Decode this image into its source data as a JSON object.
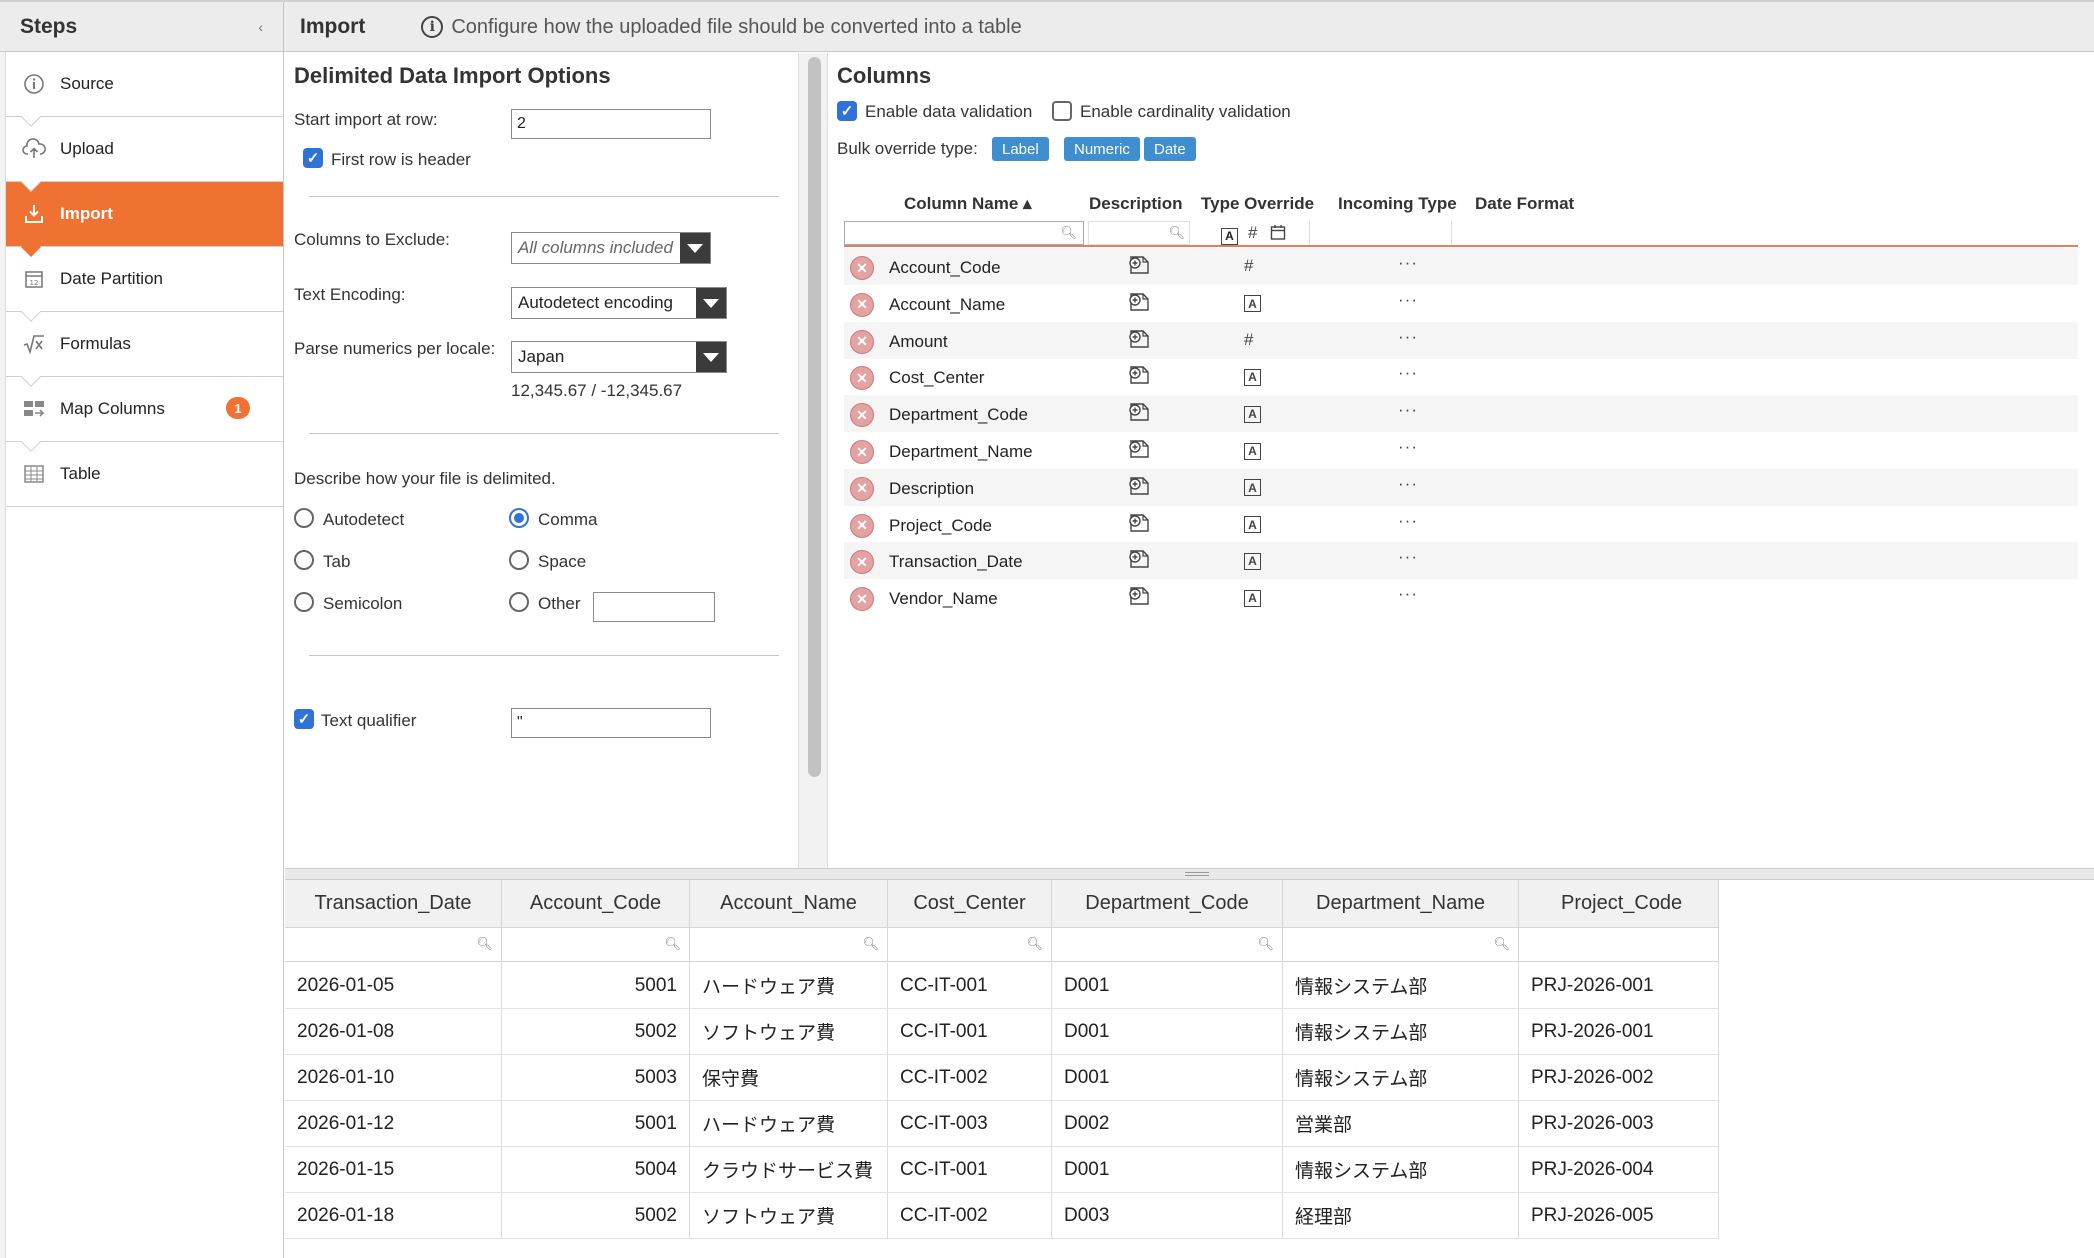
{
  "header": {
    "steps_title": "Steps",
    "collapse_glyph": "‹",
    "import_title": "Import",
    "info_text": "Configure how the uploaded file should be converted into a table"
  },
  "sidebar": {
    "items": [
      {
        "label": "Source",
        "icon": "info-icon"
      },
      {
        "label": "Upload",
        "icon": "cloud-upload-icon"
      },
      {
        "label": "Import",
        "icon": "download-tray-icon",
        "active": true
      },
      {
        "label": "Date Partition",
        "icon": "calendar-icon"
      },
      {
        "label": "Formulas",
        "icon": "sqrt-x-icon"
      },
      {
        "label": "Map Columns",
        "icon": "map-columns-icon",
        "badge": "1"
      },
      {
        "label": "Table",
        "icon": "table-grid-icon"
      }
    ]
  },
  "options": {
    "title": "Delimited Data Import Options",
    "start_row_label": "Start import at row:",
    "start_row_value": "2",
    "first_row_header_label": "First row is header",
    "exclude_label": "Columns to Exclude:",
    "exclude_value": "All columns included",
    "encoding_label": "Text Encoding:",
    "encoding_value": "Autodetect encoding",
    "locale_label": "Parse numerics per locale:",
    "locale_value": "Japan",
    "locale_example": "12,345.67 / -12,345.67",
    "delim_label": "Describe how your file is delimited.",
    "delims": {
      "autodetect": "Autodetect",
      "comma": "Comma",
      "tab": "Tab",
      "space": "Space",
      "semicolon": "Semicolon",
      "other": "Other"
    },
    "selected_delimiter": "Comma",
    "other_value": "",
    "text_qualifier_label": "Text qualifier",
    "text_qualifier_value": "\""
  },
  "columns_panel": {
    "title": "Columns",
    "enable_validation_label": "Enable data validation",
    "enable_cardinality_label": "Enable cardinality validation",
    "bulk_label": "Bulk override type:",
    "bulk_buttons": {
      "label": "Label",
      "numeric": "Numeric",
      "date": "Date"
    },
    "headers": {
      "column_name": "Column Name ▴",
      "description": "Description",
      "type_override": "Type Override",
      "incoming_type": "Incoming Type",
      "date_format": "Date Format"
    },
    "rows": [
      {
        "name": "Account_Code",
        "type": "#"
      },
      {
        "name": "Account_Name",
        "type": "A"
      },
      {
        "name": "Amount",
        "type": "#"
      },
      {
        "name": "Cost_Center",
        "type": "A"
      },
      {
        "name": "Department_Code",
        "type": "A"
      },
      {
        "name": "Department_Name",
        "type": "A"
      },
      {
        "name": "Description",
        "type": "A"
      },
      {
        "name": "Project_Code",
        "type": "A"
      },
      {
        "name": "Transaction_Date",
        "type": "A"
      },
      {
        "name": "Vendor_Name",
        "type": "A"
      }
    ],
    "dots": "···"
  },
  "grid": {
    "headers": [
      "Transaction_Date",
      "Account_Code",
      "Account_Name",
      "Cost_Center",
      "Department_Code",
      "Department_Name",
      "Project_Code"
    ],
    "rows": [
      [
        "2026-01-05",
        "5001",
        "ハードウェア費",
        "CC-IT-001",
        "D001",
        "情報システム部",
        "PRJ-2026-001"
      ],
      [
        "2026-01-08",
        "5002",
        "ソフトウェア費",
        "CC-IT-001",
        "D001",
        "情報システム部",
        "PRJ-2026-001"
      ],
      [
        "2026-01-10",
        "5003",
        "保守費",
        "CC-IT-002",
        "D001",
        "情報システム部",
        "PRJ-2026-002"
      ],
      [
        "2026-01-12",
        "5001",
        "ハードウェア費",
        "CC-IT-003",
        "D002",
        "営業部",
        "PRJ-2026-003"
      ],
      [
        "2026-01-15",
        "5004",
        "クラウドサービス費",
        "CC-IT-001",
        "D001",
        "情報システム部",
        "PRJ-2026-004"
      ],
      [
        "2026-01-18",
        "5002",
        "ソフトウェア費",
        "CC-IT-002",
        "D003",
        "経理部",
        "PRJ-2026-005"
      ]
    ]
  },
  "colors": {
    "accent": "#ef7232",
    "pill": "#3e8ed0",
    "checkbox": "#2f73d8"
  }
}
